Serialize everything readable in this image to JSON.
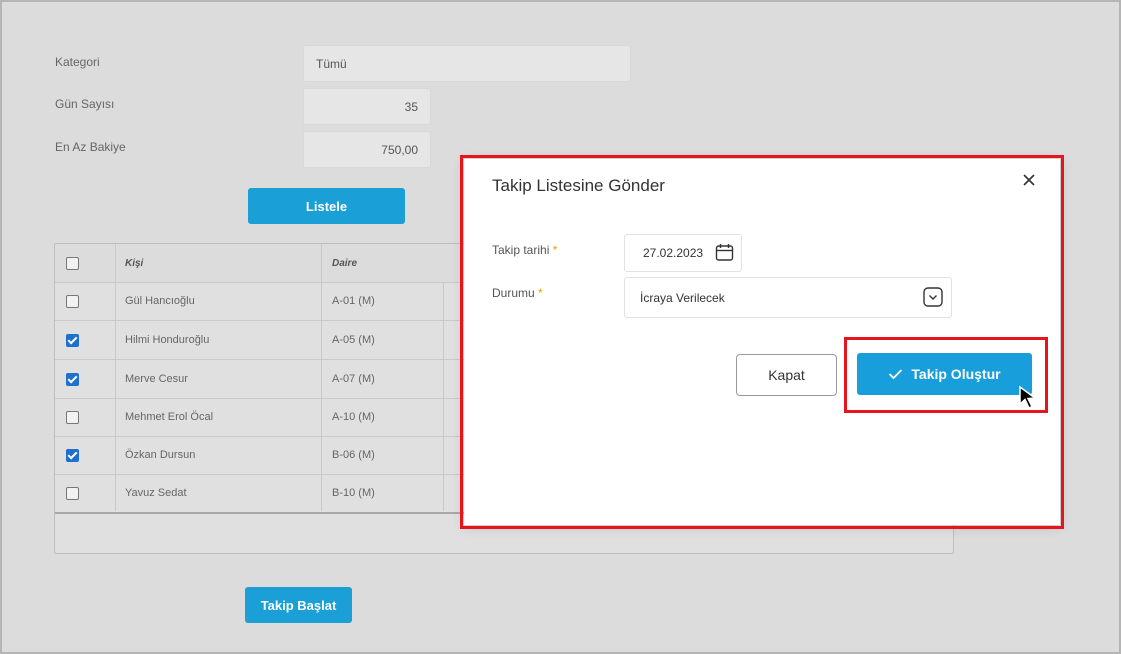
{
  "form": {
    "kategori_label": "Kategori",
    "kategori_value": "Tümü",
    "gun_sayisi_label": "Gün Sayısı",
    "gun_sayisi_value": "35",
    "en_az_bakiye_label": "En Az Bakiye",
    "en_az_bakiye_value": "750,00",
    "listele_button": "Listele"
  },
  "table": {
    "headers": {
      "kisi": "Kişi",
      "daire": "Daire"
    },
    "rows": [
      {
        "name": "Gül Hancıoğlu",
        "daire": "A-01 (M)",
        "checked": false
      },
      {
        "name": "Hilmi Honduroğlu",
        "daire": "A-05 (M)",
        "checked": true
      },
      {
        "name": "Merve Cesur",
        "daire": "A-07 (M)",
        "checked": true
      },
      {
        "name": "Mehmet Erol Öcal",
        "daire": "A-10 (M)",
        "checked": false
      },
      {
        "name": "Özkan Dursun",
        "daire": "B-06 (M)",
        "checked": true
      },
      {
        "name": "Yavuz Sedat",
        "daire": "B-10 (M)",
        "checked": false
      }
    ]
  },
  "takip_baslat_button": "Takip Başlat",
  "modal": {
    "title": "Takip Listesine Gönder",
    "takip_tarihi_label": "Takip tarihi",
    "takip_tarihi_value": "27.02.2023",
    "durumu_label": "Durumu",
    "durumu_value": "İcraya Verilecek",
    "required_mark": "*",
    "kapat_button": "Kapat",
    "takip_olustur_button": "Takip Oluştur",
    "close_icon": "close-icon",
    "calendar_icon": "calendar-icon",
    "dropdown_icon": "chevron-down-icon",
    "check_icon": "check-icon"
  },
  "colors": {
    "accent": "#189fdb",
    "highlight": "#e8141b",
    "checkbox_checked": "#1f6fd0",
    "required": "#f0a000"
  }
}
